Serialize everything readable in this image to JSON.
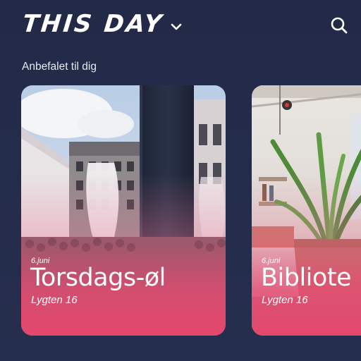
{
  "header": {
    "title": "THIS DAY",
    "chevron_icon": "chevron-down-icon",
    "search_icon": "search-icon"
  },
  "section": {
    "label": "Anbefalet til dig"
  },
  "cards": [
    {
      "date": "6.juni",
      "title": "Torsdags-øl",
      "venue": "Lygten 16"
    },
    {
      "date": "6.juni",
      "title": "Bibliote",
      "venue": "Lygten 16"
    }
  ],
  "colors": {
    "background": "#242c4a",
    "accent": "#e4486e",
    "text": "#ffffff"
  }
}
